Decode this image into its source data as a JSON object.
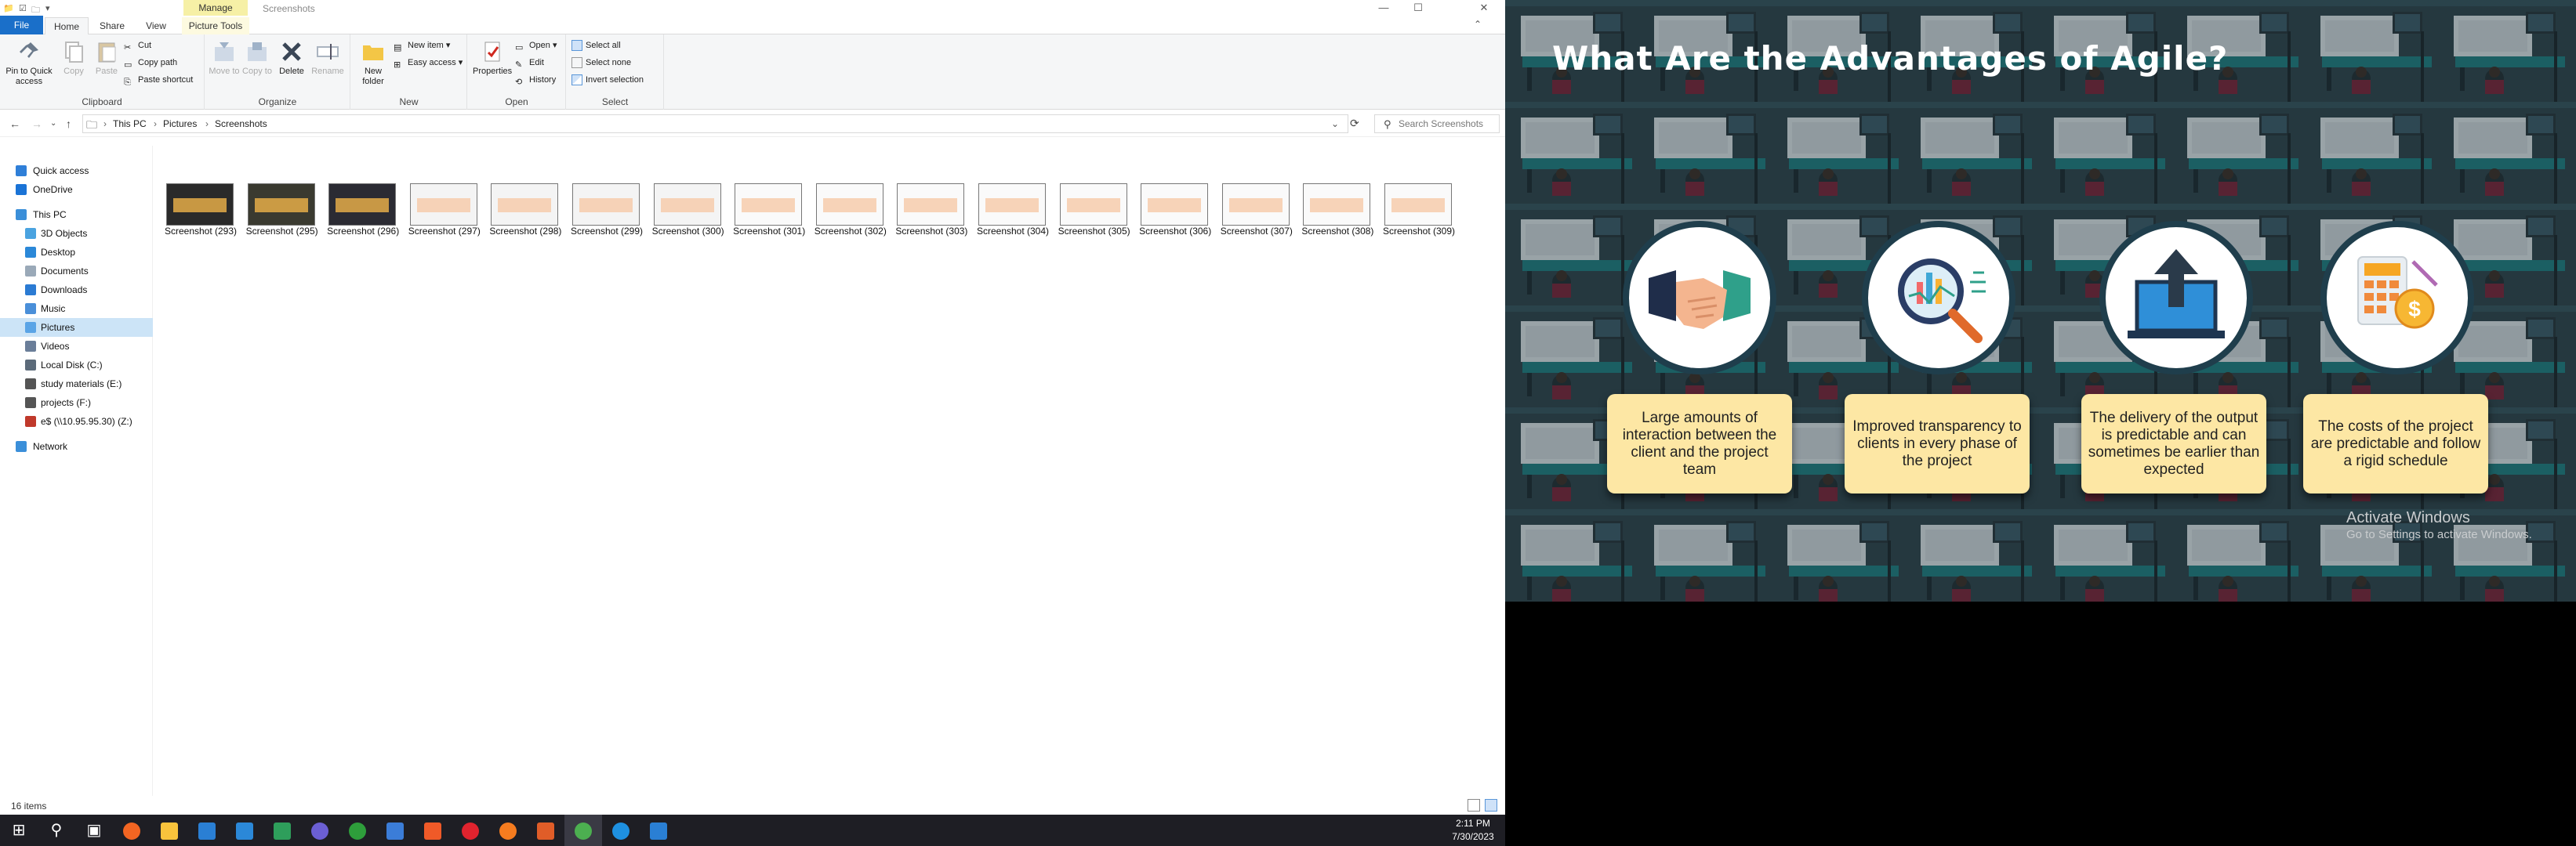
{
  "explorer": {
    "title_bar": {
      "manage_tab": "Manage",
      "window_title": "Screenshots",
      "minimize": "—",
      "maximize": "☐",
      "close": "✕"
    },
    "tabs": {
      "file": "File",
      "home": "Home",
      "share": "Share",
      "view": "View",
      "picture_tools": "Picture Tools"
    },
    "ribbon": {
      "clipboard": {
        "label": "Clipboard",
        "pin": "Pin to Quick access",
        "copy": "Copy",
        "paste": "Paste",
        "cut": "Cut",
        "copy_path": "Copy path",
        "paste_shortcut": "Paste shortcut"
      },
      "organize": {
        "label": "Organize",
        "move_to": "Move to",
        "copy_to": "Copy to",
        "delete": "Delete",
        "rename": "Rename"
      },
      "new": {
        "label": "New",
        "new_folder": "New folder",
        "new_item": "New item",
        "easy_access": "Easy access"
      },
      "open": {
        "label": "Open",
        "properties": "Properties",
        "open": "Open",
        "edit": "Edit",
        "history": "History"
      },
      "select": {
        "label": "Select",
        "select_all": "Select all",
        "select_none": "Select none",
        "invert_selection": "Invert selection"
      }
    },
    "address": {
      "crumbs": [
        "This PC",
        "Pictures",
        "Screenshots"
      ],
      "search_placeholder": "Search Screenshots"
    },
    "nav_pane": [
      {
        "label": "Quick access",
        "icon": "star-icon",
        "color": "#2f7fd8"
      },
      {
        "label": "OneDrive",
        "icon": "cloud-icon",
        "color": "#1a73d6"
      },
      {
        "label": "This PC",
        "icon": "computer-icon",
        "color": "#3b8fd9"
      },
      {
        "label": "3D Objects",
        "icon": "cube-icon",
        "color": "#4aa3e0"
      },
      {
        "label": "Desktop",
        "icon": "desktop-icon",
        "color": "#2b88d8"
      },
      {
        "label": "Documents",
        "icon": "documents-icon",
        "color": "#9aa9b8"
      },
      {
        "label": "Downloads",
        "icon": "download-icon",
        "color": "#2b7bd3"
      },
      {
        "label": "Music",
        "icon": "music-icon",
        "color": "#4a8fd9"
      },
      {
        "label": "Pictures",
        "icon": "pictures-icon",
        "color": "#5aa4e6"
      },
      {
        "label": "Videos",
        "icon": "videos-icon",
        "color": "#6a7e99"
      },
      {
        "label": "Local Disk (C:)",
        "icon": "disk-icon",
        "color": "#5c6b7a"
      },
      {
        "label": "study materials (E:)",
        "icon": "drive-icon",
        "color": "#555"
      },
      {
        "label": "projects (F:)",
        "icon": "drive-icon",
        "color": "#555"
      },
      {
        "label": "e$ (\\\\10.95.95.30) (Z:)",
        "icon": "network-drive-icon",
        "color": "#c0392b"
      },
      {
        "label": "Network",
        "icon": "network-icon",
        "color": "#3b8fd9"
      }
    ],
    "files": [
      {
        "name": "Screenshot (293)",
        "bg": "#2a2a2a"
      },
      {
        "name": "Screenshot (295)",
        "bg": "#3a3a30"
      },
      {
        "name": "Screenshot (296)",
        "bg": "#2b2b33"
      },
      {
        "name": "Screenshot (297)",
        "bg": "#f4f4f4"
      },
      {
        "name": "Screenshot (298)",
        "bg": "#f4f4f4"
      },
      {
        "name": "Screenshot (299)",
        "bg": "#f4f4f4"
      },
      {
        "name": "Screenshot (300)",
        "bg": "#f4f4f4"
      },
      {
        "name": "Screenshot (301)",
        "bg": "#fafafa"
      },
      {
        "name": "Screenshot (302)",
        "bg": "#fafafa"
      },
      {
        "name": "Screenshot (303)",
        "bg": "#fafafa"
      },
      {
        "name": "Screenshot (304)",
        "bg": "#fafafa"
      },
      {
        "name": "Screenshot (305)",
        "bg": "#fafafa"
      },
      {
        "name": "Screenshot (306)",
        "bg": "#fafafa"
      },
      {
        "name": "Screenshot (307)",
        "bg": "#fafafa"
      },
      {
        "name": "Screenshot (308)",
        "bg": "#fafafa"
      },
      {
        "name": "Screenshot (309)",
        "bg": "#fafafa"
      }
    ],
    "status": {
      "count": "16 items"
    }
  },
  "taskbar": {
    "time": "2:11 PM",
    "date": "7/30/2023",
    "apps": [
      {
        "icon": "windows-start-icon",
        "color": "#ffffff"
      },
      {
        "icon": "search-icon",
        "color": "#ffffff"
      },
      {
        "icon": "task-view-icon",
        "color": "#ffffff"
      },
      {
        "icon": "app-orange-icon",
        "color": "#f26522"
      },
      {
        "icon": "file-explorer-icon",
        "color": "#f8c33c"
      },
      {
        "icon": "store-icon",
        "color": "#2a7fd4"
      },
      {
        "icon": "mail-icon",
        "color": "#2b88d8"
      },
      {
        "icon": "store-bag-icon",
        "color": "#2e9e5b"
      },
      {
        "icon": "media-icon",
        "color": "#6b5fd3"
      },
      {
        "icon": "xbox-icon",
        "color": "#2e9e3b"
      },
      {
        "icon": "photos-icon",
        "color": "#3b7dd8"
      },
      {
        "icon": "app-brave-icon",
        "color": "#f05a28"
      },
      {
        "icon": "opera-icon",
        "color": "#e0232e"
      },
      {
        "icon": "firefox-icon",
        "color": "#f57c1f"
      },
      {
        "icon": "app-grid-icon",
        "color": "#e05d28"
      },
      {
        "icon": "chrome-icon",
        "color": "#4caf50"
      },
      {
        "icon": "skype-icon",
        "color": "#1e90e0"
      },
      {
        "icon": "photo-viewer-icon",
        "color": "#2a7fd4"
      }
    ]
  },
  "slide": {
    "title": "What Are the Advantages of Agile?",
    "cards": [
      {
        "text": "Large amounts of interaction between the client and the project team",
        "icon": "handshake-icon"
      },
      {
        "text": "Improved transparency to clients in every phase of the project",
        "icon": "magnifier-chart-icon"
      },
      {
        "text": "The delivery of the output is predictable and can sometimes be earlier than expected",
        "icon": "laptop-upload-icon"
      },
      {
        "text": "The costs of the project are predictable and follow a rigid schedule",
        "icon": "calculator-coin-icon"
      }
    ],
    "watermark_title": "Activate Windows",
    "watermark_sub": "Go to Settings to activate Windows."
  }
}
